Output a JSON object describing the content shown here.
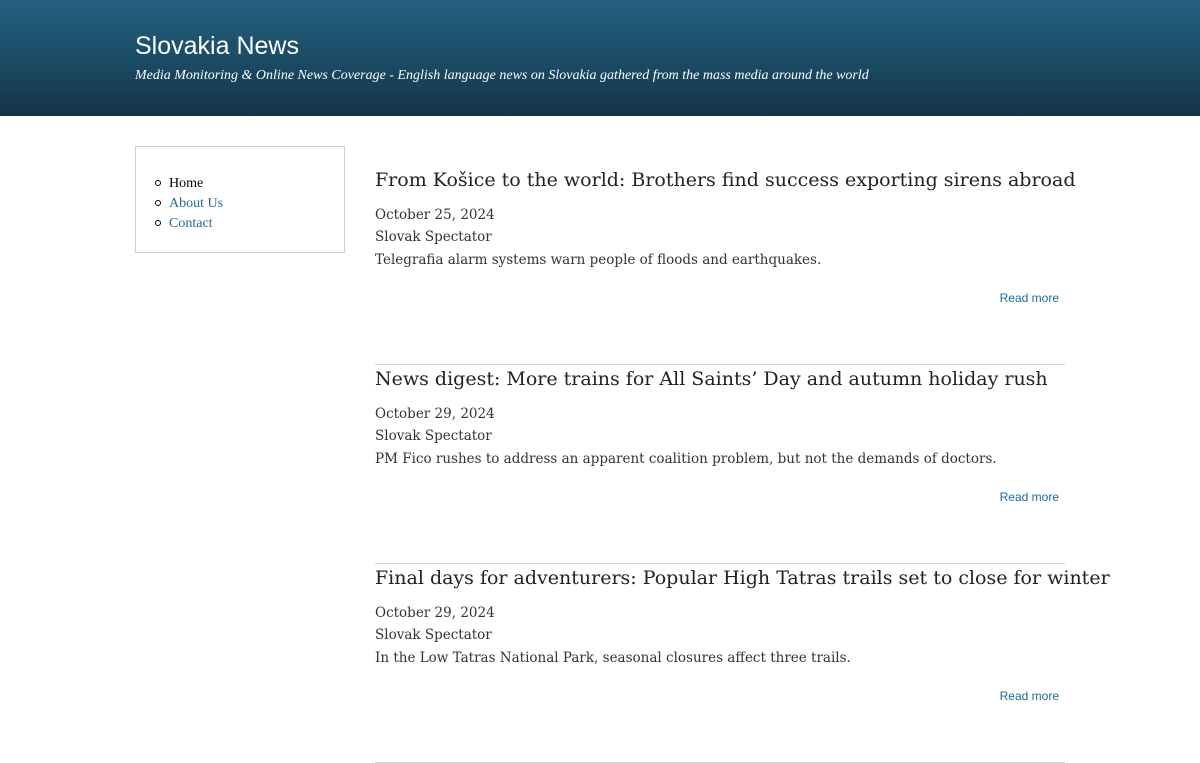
{
  "header": {
    "site_title": "Slovakia News",
    "tagline": "Media Monitoring & Online News Coverage - English language news on Slovakia gathered from the mass media around the world"
  },
  "sidebar": {
    "items": [
      {
        "label": "Home"
      },
      {
        "label": "About Us"
      },
      {
        "label": "Contact"
      }
    ]
  },
  "articles": [
    {
      "title": "From Košice to the world: Brothers find success exporting sirens abroad",
      "date": "October 25, 2024",
      "source": "Slovak Spectator",
      "summary": "Telegrafia alarm systems warn people of floods and earthquakes.",
      "read_more": "Read more"
    },
    {
      "title": "News digest: More trains for All Saints’ Day and autumn holiday rush",
      "date": "October 29, 2024",
      "source": "Slovak Spectator",
      "summary": "PM Fico rushes to address an apparent coalition problem, but not the demands of doctors.",
      "read_more": "Read more"
    },
    {
      "title": "Final days for adventurers: Popular High Tatras trails set to close for winter",
      "date": "October 29, 2024",
      "source": "Slovak Spectator",
      "summary": "In the Low Tatras National Park, seasonal closures affect three trails.",
      "read_more": "Read more"
    }
  ],
  "colors": {
    "header_top": "#22607f",
    "header_bottom": "#153447",
    "link": "#1f6a96",
    "divider": "#d6d6d6"
  }
}
